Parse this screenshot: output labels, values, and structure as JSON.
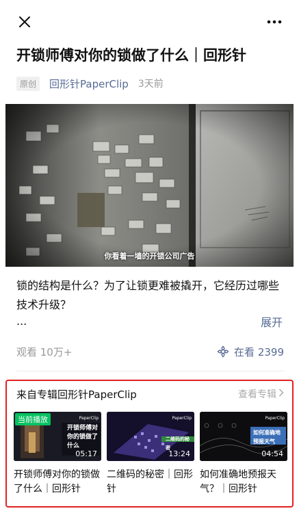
{
  "article": {
    "title": "开锁师傅对你的锁做了什么｜回形针",
    "original_tag": "原创",
    "author": "回形针PaperClip",
    "time": "3天前"
  },
  "video": {
    "caption": "你看着一墙的开锁公司广告"
  },
  "description": {
    "text": "锁的结构是什么？为了让锁更难被撬开，它经历过哪些技术升级？",
    "ellipsis": "...",
    "expand_label": "展开"
  },
  "stats": {
    "views": "观看 10万+",
    "watching": "在看 2399"
  },
  "album": {
    "title": "来自专辑回形针PaperClip",
    "more_label": "查看专辑",
    "items": [
      {
        "title": "开锁师傅对你的锁做了什么｜回形针",
        "duration": "05:17",
        "badge": "当前播放",
        "thumb_text": "开锁师傅对你的锁做了什么",
        "brand": "PaperClip"
      },
      {
        "title": "二维码的秘密｜回形针",
        "duration": "13:24",
        "badge": "",
        "thumb_text": "二维码的秘密",
        "brand": "PaperClip"
      },
      {
        "title": "如何准确地预报天气？｜回形针",
        "duration": "04:54",
        "badge": "",
        "thumb_text": "如何准确地预报天气",
        "brand": "PaperClip"
      }
    ]
  },
  "icons": {
    "close": "close-icon",
    "more": "more-icon",
    "watching": "flower-icon",
    "chevron": "chevron-right-icon"
  },
  "colors": {
    "link": "#576b95",
    "highlight_border": "#e02020",
    "playing_badge": "#07c160"
  }
}
